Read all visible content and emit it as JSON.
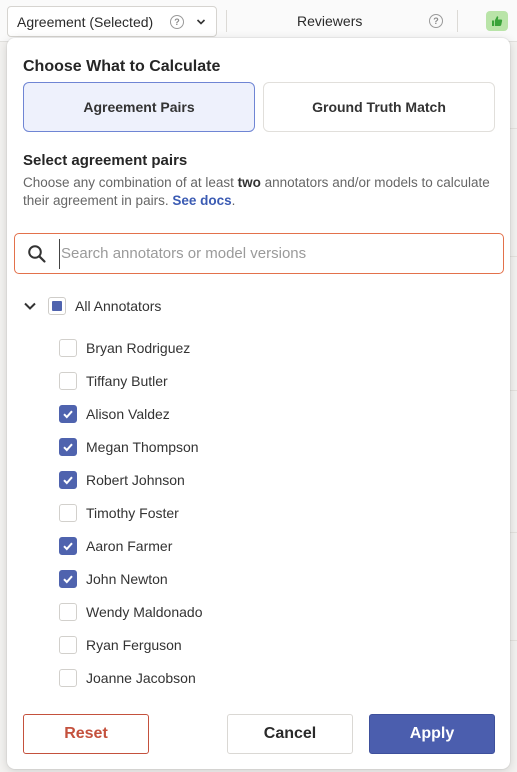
{
  "header": {
    "column_select": "Agreement (Selected)",
    "reviewers_label": "Reviewers",
    "help_glyph": "?",
    "accent_badge_color": "#b9e4a8"
  },
  "popover": {
    "calc_title": "Choose What to Calculate",
    "modes": [
      {
        "label": "Agreement Pairs",
        "selected": true
      },
      {
        "label": "Ground Truth Match",
        "selected": false
      }
    ],
    "pairs_title": "Select agreement pairs",
    "description": {
      "part1": "Choose any combination of at least ",
      "bold": "two",
      "part2": " annotators and/or models to calculate their agreement in pairs. ",
      "link": "See docs",
      "part3": "."
    },
    "search": {
      "placeholder": "Search annotators or model versions",
      "value": ""
    },
    "tree": {
      "root_label": "All Annotators",
      "root_state": "partial",
      "expanded": true,
      "annotators": [
        {
          "name": "Bryan Rodriguez",
          "checked": false
        },
        {
          "name": "Tiffany Butler",
          "checked": false
        },
        {
          "name": "Alison Valdez",
          "checked": true
        },
        {
          "name": "Megan Thompson",
          "checked": true
        },
        {
          "name": "Robert Johnson",
          "checked": true
        },
        {
          "name": "Timothy Foster",
          "checked": false
        },
        {
          "name": "Aaron Farmer",
          "checked": true
        },
        {
          "name": "John Newton",
          "checked": true
        },
        {
          "name": "Wendy Maldonado",
          "checked": false
        },
        {
          "name": "Ryan Ferguson",
          "checked": false
        },
        {
          "name": "Joanne Jacobson",
          "checked": false
        }
      ]
    },
    "buttons": {
      "reset": "Reset",
      "cancel": "Cancel",
      "apply": "Apply"
    },
    "colors": {
      "primary": "#4b5eae",
      "danger": "#c4513d",
      "focus": "#e3714b"
    }
  }
}
